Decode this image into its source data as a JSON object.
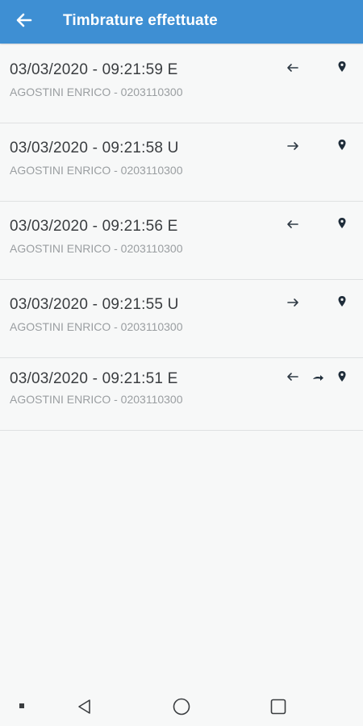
{
  "appbar": {
    "title": "Timbrature effettuate",
    "back_icon": "arrow-left-icon",
    "color": "#3e8fd3"
  },
  "records": [
    {
      "title": "03/03/2020 - 09:21:59 E",
      "subtitle": "AGOSTINI ENRICO - 0203110300",
      "direction": "in"
    },
    {
      "title": "03/03/2020 - 09:21:58 U",
      "subtitle": "AGOSTINI ENRICO - 0203110300",
      "direction": "out"
    },
    {
      "title": "03/03/2020 - 09:21:56 E",
      "subtitle": "AGOSTINI ENRICO - 0203110300",
      "direction": "in"
    },
    {
      "title": "03/03/2020 - 09:21:55 U",
      "subtitle": "AGOSTINI ENRICO - 0203110300",
      "direction": "out"
    },
    {
      "title": "03/03/2020 - 09:21:51 E",
      "subtitle": "AGOSTINI ENRICO - 0203110300",
      "direction": "in",
      "extra_icon": "redo-arrow-icon"
    }
  ],
  "icons": {
    "entry": "arrow-left-icon",
    "exit": "arrow-right-icon",
    "location": "map-pin-icon"
  },
  "navbar": {
    "items": [
      "menu-dot-icon",
      "back-triangle-icon",
      "home-circle-icon",
      "recents-square-icon"
    ]
  }
}
